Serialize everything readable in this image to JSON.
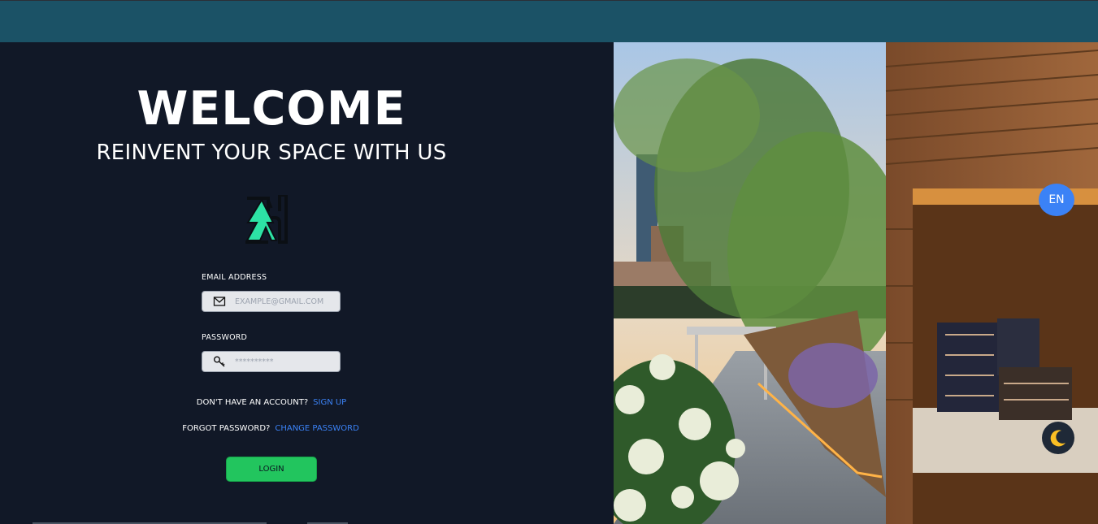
{
  "header": {
    "color": "#1b5266"
  },
  "hero": {
    "title": "WELCOME",
    "subtitle": "REINVENT YOUR SPACE WITH US"
  },
  "form": {
    "email": {
      "label": "EMAIL ADDRESS",
      "placeholder": "EXAMPLE@GMAIL.COM",
      "icon": "mail-icon"
    },
    "password": {
      "label": "PASSWORD",
      "placeholder": "**********",
      "icon": "key-icon"
    },
    "signup": {
      "prompt": "DON'T HAVE AN ACCOUNT?",
      "link": "SIGN UP"
    },
    "forgot": {
      "prompt": "FORGOT PASSWORD?",
      "link": "CHANGE PASSWORD"
    },
    "login_label": "LOGIN"
  },
  "controls": {
    "language": "EN",
    "theme_icon": "moon-icon"
  },
  "colors": {
    "accent": "#22c55e",
    "link": "#3b82f6",
    "background": "#111827"
  }
}
